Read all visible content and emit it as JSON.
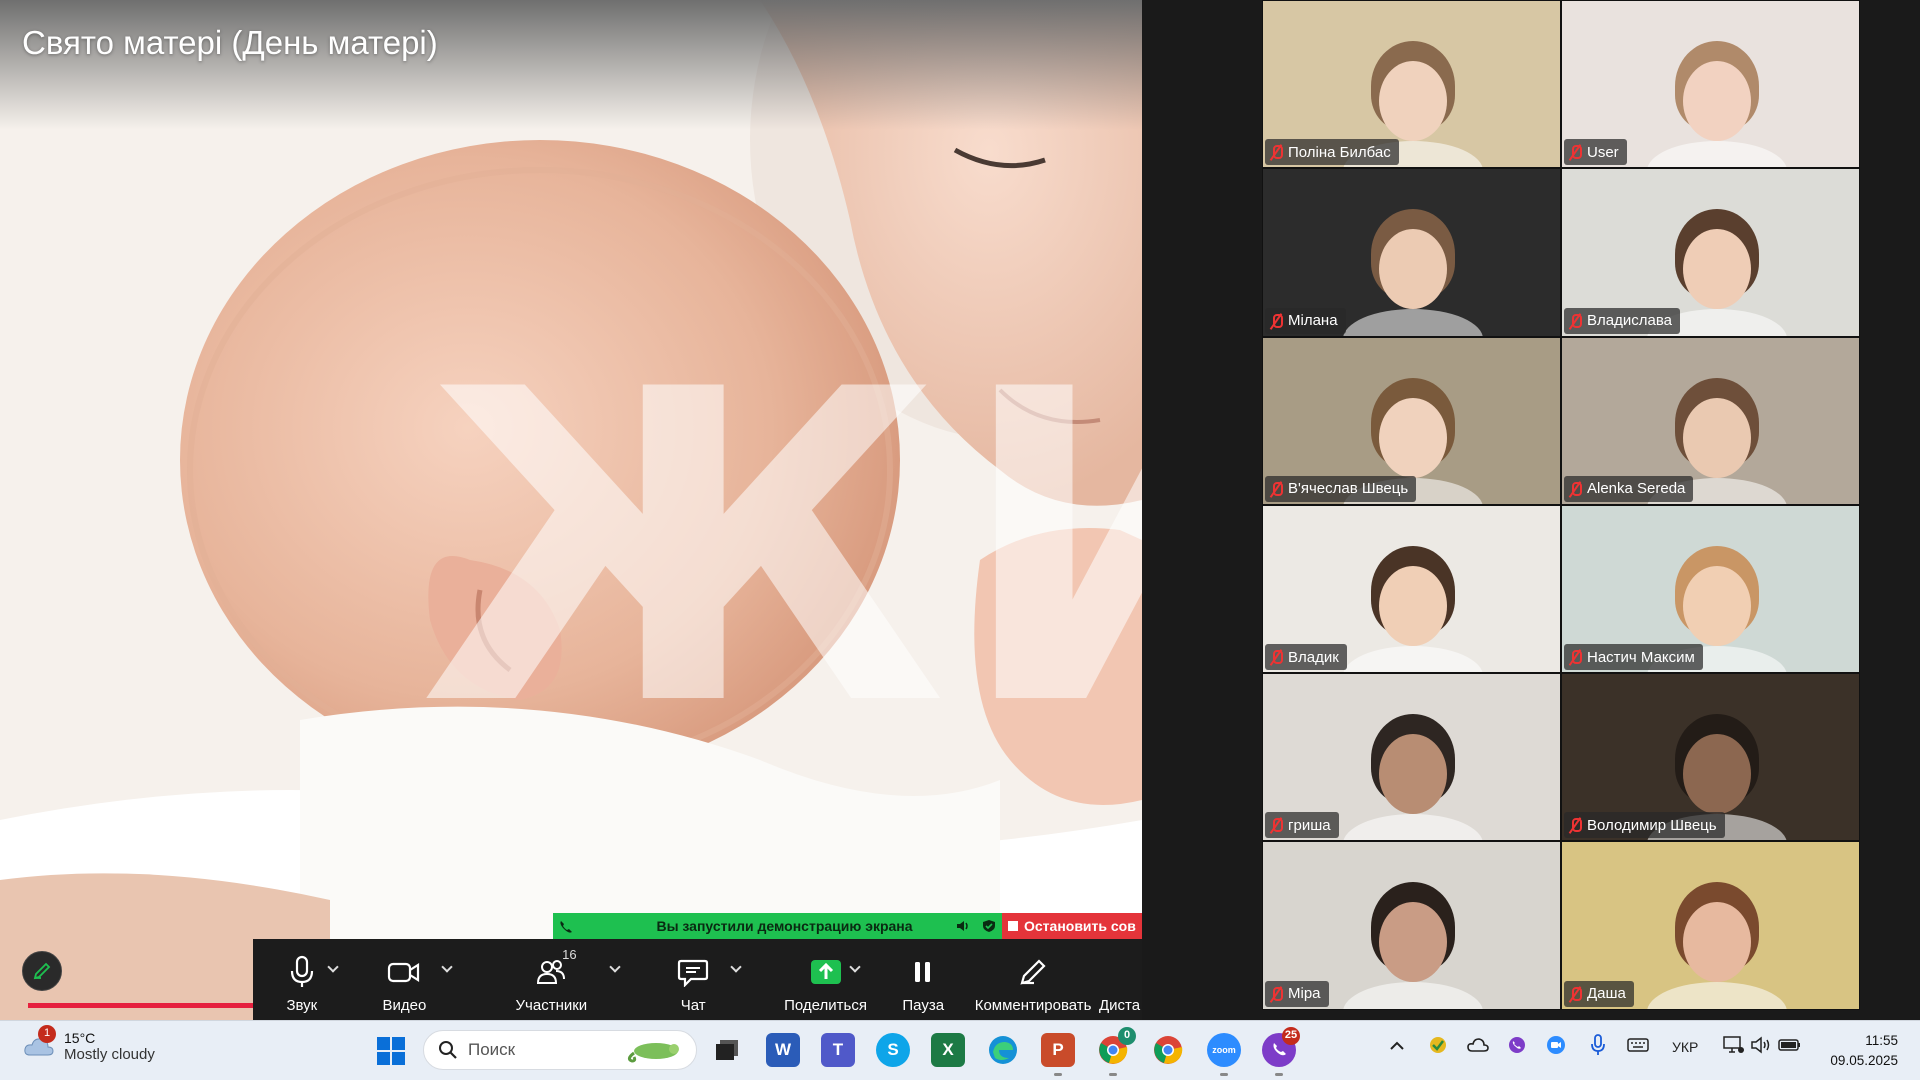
{
  "share": {
    "title": "Свято матері (День матері)",
    "overlay_word": "ЖИТ"
  },
  "banner": {
    "message": "Вы запустили демонстрацию экрана",
    "stop_label": "Остановить сов"
  },
  "toolbar": {
    "items": [
      {
        "label": "Звук",
        "icon": "microphone-icon"
      },
      {
        "label": "Видео",
        "icon": "video-camera-icon"
      },
      {
        "label": "Участники",
        "icon": "participants-icon",
        "count": "16"
      },
      {
        "label": "Чат",
        "icon": "chat-icon"
      },
      {
        "label": "Поделиться",
        "icon": "share-screen-icon"
      },
      {
        "label": "Пауза",
        "icon": "pause-icon"
      },
      {
        "label": "Комментировать",
        "icon": "annotate-pen-icon"
      },
      {
        "label": "Диста",
        "icon": "remote-control-icon"
      }
    ]
  },
  "gallery": {
    "participants": [
      {
        "name": "Поліна Билбас",
        "muted": true,
        "bg": "#d7c7a4",
        "skin": "#f0d2bd",
        "hair": "#8a6a4e"
      },
      {
        "name": "User",
        "muted": true,
        "bg": "#e9e2de",
        "skin": "#f2d2c1",
        "hair": "#b08a6a"
      },
      {
        "name": "Мілана",
        "muted": true,
        "bg": "#2c2c2c",
        "skin": "#eccbb3",
        "hair": "#7a5b43"
      },
      {
        "name": "Владислава",
        "muted": true,
        "bg": "#dcdcd7",
        "skin": "#efcdb6",
        "hair": "#5a3f2e"
      },
      {
        "name": "В'ячеслав Швець",
        "muted": true,
        "bg": "#a89c85",
        "skin": "#f0d2bd",
        "hair": "#7a5a3c"
      },
      {
        "name": "Alenka Sereda",
        "muted": true,
        "bg": "#b3a89a",
        "skin": "#eac9b1",
        "hair": "#6e4f3a"
      },
      {
        "name": "Владик",
        "muted": true,
        "bg": "#ece9e4",
        "skin": "#f0cfb6",
        "hair": "#4a3426"
      },
      {
        "name": "Настич Максим",
        "muted": true,
        "bg": "#cfd9d5",
        "skin": "#f1cfb3",
        "hair": "#c99665"
      },
      {
        "name": "гриша",
        "muted": true,
        "bg": "#dedad5",
        "skin": "#b88d73",
        "hair": "#2e2622"
      },
      {
        "name": "Володимир Швець",
        "muted": true,
        "bg": "#3b3128",
        "skin": "#8c6750",
        "hair": "#231c17"
      },
      {
        "name": "Міра",
        "muted": true,
        "bg": "#d8d5cf",
        "skin": "#c99c85",
        "hair": "#2a211c"
      },
      {
        "name": "Даша",
        "muted": true,
        "bg": "#d8c483",
        "skin": "#e7b99f",
        "hair": "#7a4a2e"
      }
    ]
  },
  "taskbar": {
    "weather_temp": "15°C",
    "weather_desc": "Mostly cloudy",
    "weather_badge": "1",
    "search_placeholder": "Поиск",
    "language": "УКР",
    "time": "11:55",
    "date": "09.05.2025",
    "chrome_badge": "0",
    "viber_badge": "25"
  },
  "colors": {
    "banner_green": "#1ec050",
    "banner_red": "#e4343a",
    "progress_red": "#e6203e",
    "mute_red": "#ee3333"
  }
}
